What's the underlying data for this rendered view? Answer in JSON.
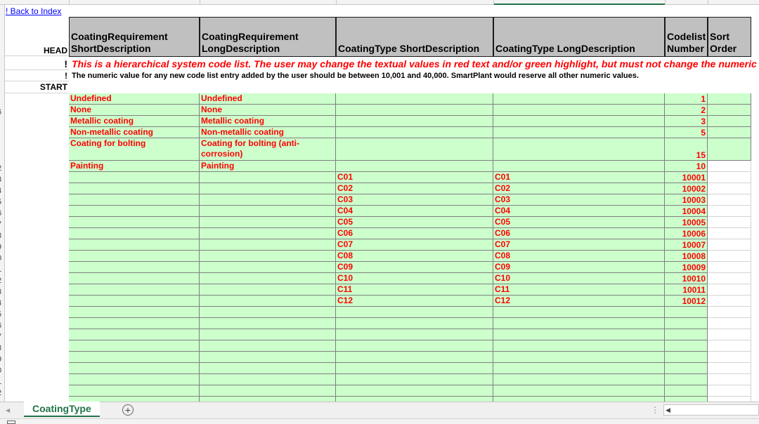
{
  "back_link": "! Back to Index",
  "labels": {
    "head": "HEAD",
    "bang1": "!",
    "bang2": "!",
    "start": "START"
  },
  "headers": {
    "cr_short": "CoatingRequirement ShortDescription",
    "cr_long": "CoatingRequirement LongDescription",
    "ct_short": "CoatingType ShortDescription",
    "ct_long": "CoatingType LongDescription",
    "codelist": "Codelist Number",
    "sort": "Sort Order"
  },
  "notes": {
    "note1": "This is a hierarchical system code list. The user may change the textual values in red text and/or green highlight, but must not change the numeric va",
    "note2": "The numeric value for any new code list entry added by the user should be between 10,001 and 40,000. SmartPlant would reserve all other numeric values."
  },
  "rows": [
    {
      "cr_short": "Undefined",
      "cr_long": "Undefined",
      "ct_short": "",
      "ct_long": "",
      "num": "1"
    },
    {
      "cr_short": "None",
      "cr_long": "None",
      "ct_short": "",
      "ct_long": "",
      "num": "2"
    },
    {
      "cr_short": "Metallic coating",
      "cr_long": "Metallic coating",
      "ct_short": "",
      "ct_long": "",
      "num": "3"
    },
    {
      "cr_short": "Non-metallic coating",
      "cr_long": "Non-metallic coating",
      "ct_short": "",
      "ct_long": "",
      "num": "5"
    },
    {
      "cr_short": "Coating for bolting",
      "cr_long": "Coating for bolting (anti-corrosion)",
      "ct_short": "",
      "ct_long": "",
      "num": "15"
    },
    {
      "cr_short": "Painting",
      "cr_long": "Painting",
      "ct_short": "",
      "ct_long": "",
      "num": "10"
    },
    {
      "cr_short": "",
      "cr_long": "",
      "ct_short": "C01",
      "ct_long": "C01",
      "num": "10001"
    },
    {
      "cr_short": "",
      "cr_long": "",
      "ct_short": "C02",
      "ct_long": "C02",
      "num": "10002"
    },
    {
      "cr_short": "",
      "cr_long": "",
      "ct_short": "C03",
      "ct_long": "C03",
      "num": "10003"
    },
    {
      "cr_short": "",
      "cr_long": "",
      "ct_short": "C04",
      "ct_long": "C04",
      "num": "10004"
    },
    {
      "cr_short": "",
      "cr_long": "",
      "ct_short": "C05",
      "ct_long": "C05",
      "num": "10005"
    },
    {
      "cr_short": "",
      "cr_long": "",
      "ct_short": "C06",
      "ct_long": "C06",
      "num": "10006"
    },
    {
      "cr_short": "",
      "cr_long": "",
      "ct_short": "C07",
      "ct_long": "C07",
      "num": "10007"
    },
    {
      "cr_short": "",
      "cr_long": "",
      "ct_short": "C08",
      "ct_long": "C08",
      "num": "10008"
    },
    {
      "cr_short": "",
      "cr_long": "",
      "ct_short": "C09",
      "ct_long": "C09",
      "num": "10009"
    },
    {
      "cr_short": "",
      "cr_long": "",
      "ct_short": "C10",
      "ct_long": "C10",
      "num": "10010"
    },
    {
      "cr_short": "",
      "cr_long": "",
      "ct_short": "C11",
      "ct_long": "C11",
      "num": "10011"
    },
    {
      "cr_short": "",
      "cr_long": "",
      "ct_short": "C12",
      "ct_long": "C12",
      "num": "10012"
    }
  ],
  "row_numbers": [
    "6",
    "2",
    "3",
    "4",
    "5",
    "6",
    "7",
    "8",
    "9",
    "0",
    "1",
    "2",
    "3",
    "4",
    "5",
    "6",
    "7",
    "8",
    "9",
    "0",
    "1",
    "2"
  ],
  "sheet_tab": "CoatingType",
  "add_sheet_icon": "plus-circle-icon",
  "colors": {
    "red_text": "#ff0000",
    "green_fill": "#ccffcc",
    "header_fill": "#c0c0c0",
    "excel_green": "#217346",
    "link": "#0000ff"
  }
}
